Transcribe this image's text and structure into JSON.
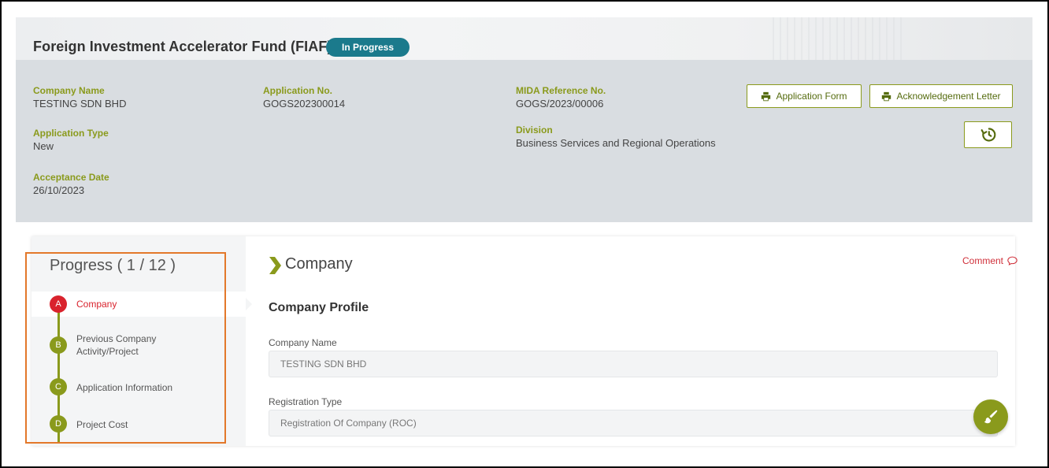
{
  "header": {
    "title": "Foreign Investment Accelerator Fund (FIAF)",
    "status": "In Progress"
  },
  "info": {
    "company_name_label": "Company Name",
    "company_name": "TESTING SDN BHD",
    "application_no_label": "Application No.",
    "application_no": "GOGS202300014",
    "mida_ref_label": "MIDA Reference No.",
    "mida_ref": "GOGS/2023/00006",
    "application_type_label": "Application Type",
    "application_type": "New",
    "division_label": "Division",
    "division": "Business Services and Regional Operations",
    "acceptance_date_label": "Acceptance Date",
    "acceptance_date": "26/10/2023"
  },
  "actions": {
    "application_form": "Application Form",
    "acknowledgement_letter": "Acknowledgement Letter",
    "history_icon": "history-icon"
  },
  "progress": {
    "title": "Progress ( 1 / 12 )",
    "steps": [
      {
        "letter": "A",
        "label": "Company",
        "active": true
      },
      {
        "letter": "B",
        "label": "Previous Company Activity/Project"
      },
      {
        "letter": "C",
        "label": "Application Information"
      },
      {
        "letter": "D",
        "label": "Project Cost"
      }
    ]
  },
  "section": {
    "title": "Company",
    "comment": "Comment",
    "subheading": "Company Profile",
    "fields": [
      {
        "label": "Company Name",
        "value": "TESTING SDN BHD"
      },
      {
        "label": "Registration Type",
        "value": "Registration Of Company (ROC)"
      }
    ]
  },
  "colors": {
    "accent_olive": "#8a9a1c",
    "status_teal": "#1b7a8c",
    "active_red": "#d9232d",
    "highlight_orange": "#e3782a"
  }
}
